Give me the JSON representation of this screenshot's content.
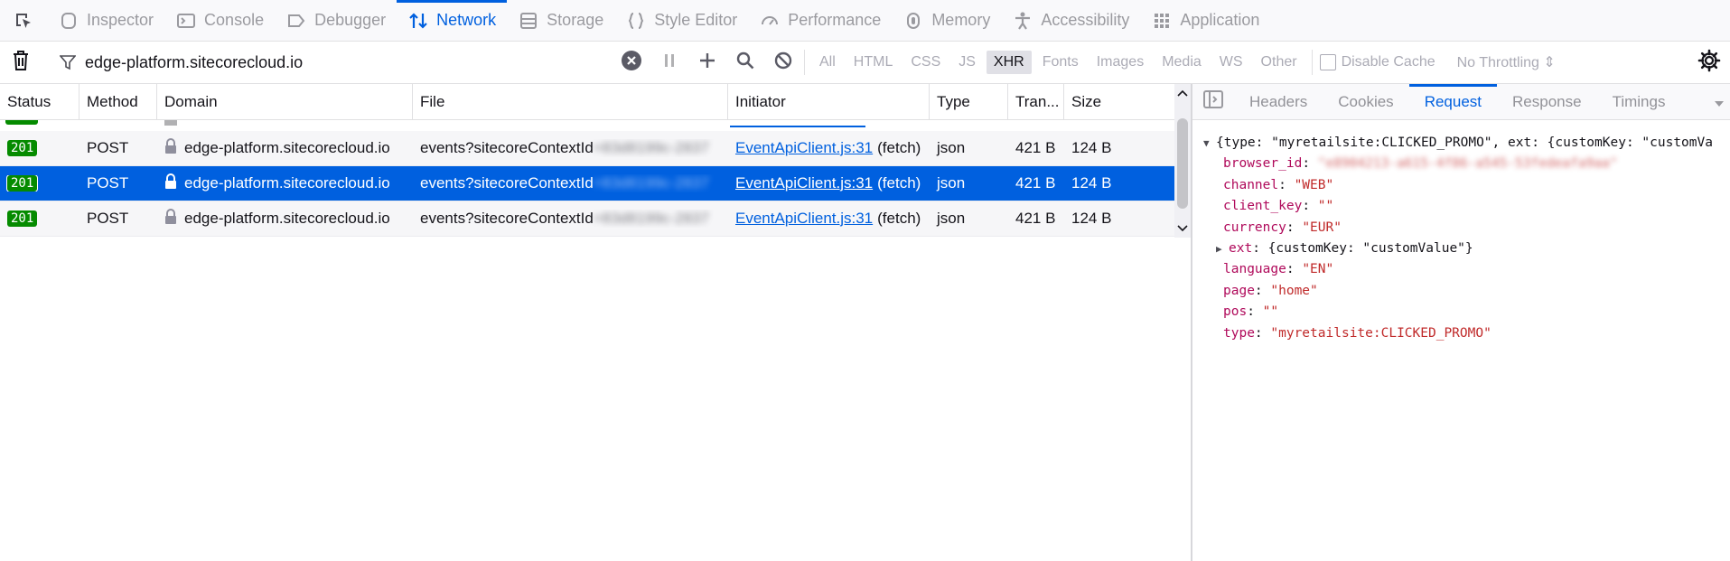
{
  "toolbar": {
    "tabs": [
      {
        "label": "Inspector",
        "icon": "inspector-icon"
      },
      {
        "label": "Console",
        "icon": "console-icon"
      },
      {
        "label": "Debugger",
        "icon": "debugger-icon"
      },
      {
        "label": "Network",
        "icon": "network-icon",
        "active": true
      },
      {
        "label": "Storage",
        "icon": "storage-icon"
      },
      {
        "label": "Style Editor",
        "icon": "style-editor-icon"
      },
      {
        "label": "Performance",
        "icon": "performance-icon"
      },
      {
        "label": "Memory",
        "icon": "memory-icon"
      },
      {
        "label": "Accessibility",
        "icon": "accessibility-icon"
      },
      {
        "label": "Application",
        "icon": "application-icon"
      }
    ]
  },
  "filterbar": {
    "filter_value": "edge-platform.sitecorecloud.io",
    "type_filters": [
      "All",
      "HTML",
      "CSS",
      "JS",
      "XHR",
      "Fonts",
      "Images",
      "Media",
      "WS",
      "Other"
    ],
    "selected_type": "XHR",
    "disable_cache_label": "Disable Cache",
    "throttling_label": "No Throttling ⇕"
  },
  "table": {
    "columns": [
      "Status",
      "Method",
      "Domain",
      "File",
      "Initiator",
      "Type",
      "Tran...",
      "Size"
    ],
    "rows": [
      {
        "status": "201",
        "method": "POST",
        "domain": "edge-platform.sitecorecloud.io",
        "file": "events?sitecoreContextId",
        "file_hidden": "=83d8199c-2837",
        "initiator_link": "EventApiClient.js:31",
        "initiator_suffix": "(fetch)",
        "type": "json",
        "transferred": "421 B",
        "size": "124 B"
      },
      {
        "status": "201",
        "method": "POST",
        "domain": "edge-platform.sitecorecloud.io",
        "file": "events?sitecoreContextId",
        "file_hidden": "=83d8199c-2837",
        "initiator_link": "EventApiClient.js:31",
        "initiator_suffix": "(fetch)",
        "type": "json",
        "transferred": "421 B",
        "size": "124 B",
        "selected": true
      },
      {
        "status": "201",
        "method": "POST",
        "domain": "edge-platform.sitecorecloud.io",
        "file": "events?sitecoreContextId",
        "file_hidden": "=83d8199c-2837",
        "initiator_link": "EventApiClient.js:31",
        "initiator_suffix": "(fetch)",
        "type": "json",
        "transferred": "421 B",
        "size": "124 B"
      }
    ]
  },
  "details": {
    "tabs": [
      "Headers",
      "Cookies",
      "Request",
      "Response",
      "Timings"
    ],
    "active_tab": "Request",
    "summary": "{type: \"myretailsite:CLICKED_PROMO\", ext: {customKey: \"customVa",
    "fields": [
      {
        "key": "browser_id",
        "value": "\"e8904213-a615-4f86-a545-53fedeafa9aa\"",
        "hidden": true
      },
      {
        "key": "channel",
        "value": "\"WEB\""
      },
      {
        "key": "client_key",
        "value": "\"\""
      },
      {
        "key": "currency",
        "value": "\"EUR\""
      },
      {
        "key": "ext",
        "value": "{customKey: \"customValue\"}",
        "expandable": true
      },
      {
        "key": "language",
        "value": "\"EN\""
      },
      {
        "key": "page",
        "value": "\"home\""
      },
      {
        "key": "pos",
        "value": "\"\""
      },
      {
        "key": "type",
        "value": "\"myretailsite:CLICKED_PROMO\""
      }
    ]
  },
  "colors": {
    "accent": "#0060df",
    "status_ok": "#058b00",
    "json_key": "#b00a5b",
    "json_string": "#c02a2a"
  }
}
